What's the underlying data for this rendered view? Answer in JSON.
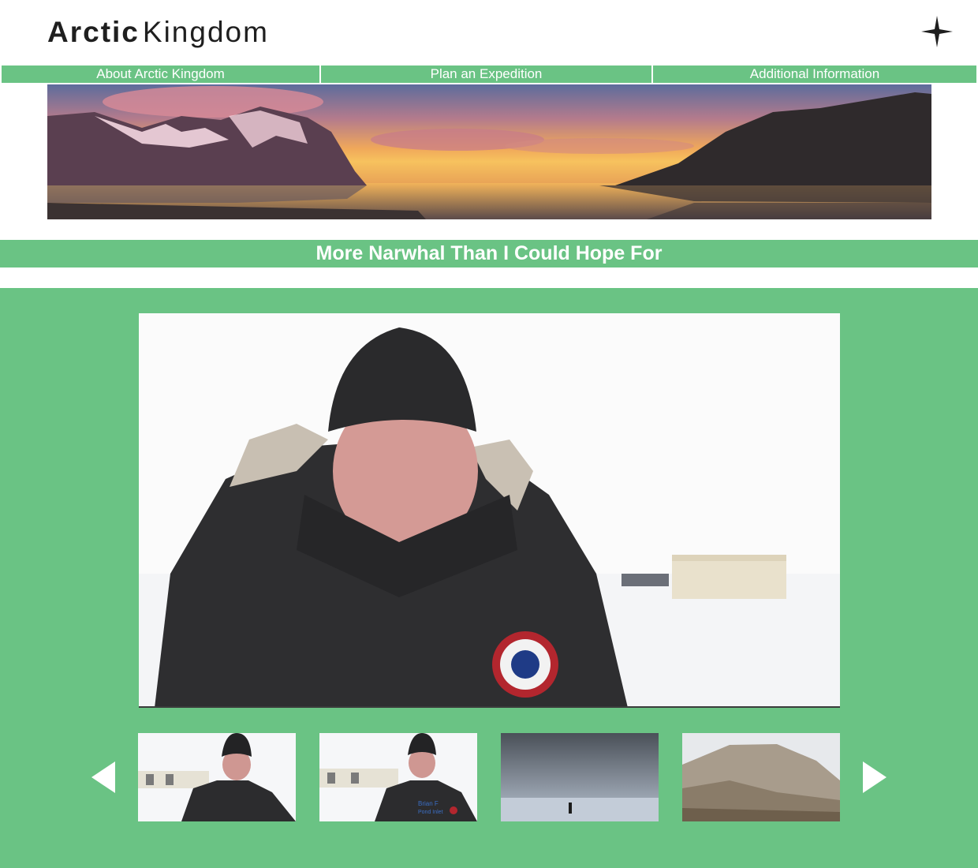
{
  "brand": {
    "name_bold": "Arctic",
    "name_light": "Kingdom",
    "icon": "four-point-star-icon"
  },
  "nav": {
    "items": [
      {
        "label": "About Arctic Kingdom"
      },
      {
        "label": "Plan an Expedition"
      },
      {
        "label": "Additional Information"
      }
    ]
  },
  "banner": {
    "description": "panoramic-sunset-fjord"
  },
  "page_title": "More Narwhal Than I Could Hope For",
  "gallery": {
    "prev_icon": "triangle-left-icon",
    "next_icon": "triangle-right-icon",
    "thumbnails": [
      {
        "name": "interview-tent-1"
      },
      {
        "name": "interview-tent-2"
      },
      {
        "name": "storm-ice-walker"
      },
      {
        "name": "rocky-hillside"
      }
    ],
    "lower_third": {
      "line1": "Brian F",
      "line2": "Pond Inlet"
    }
  },
  "colors": {
    "accent_green": "#6ac384",
    "text_dark": "#1f1f1f",
    "white": "#ffffff"
  }
}
